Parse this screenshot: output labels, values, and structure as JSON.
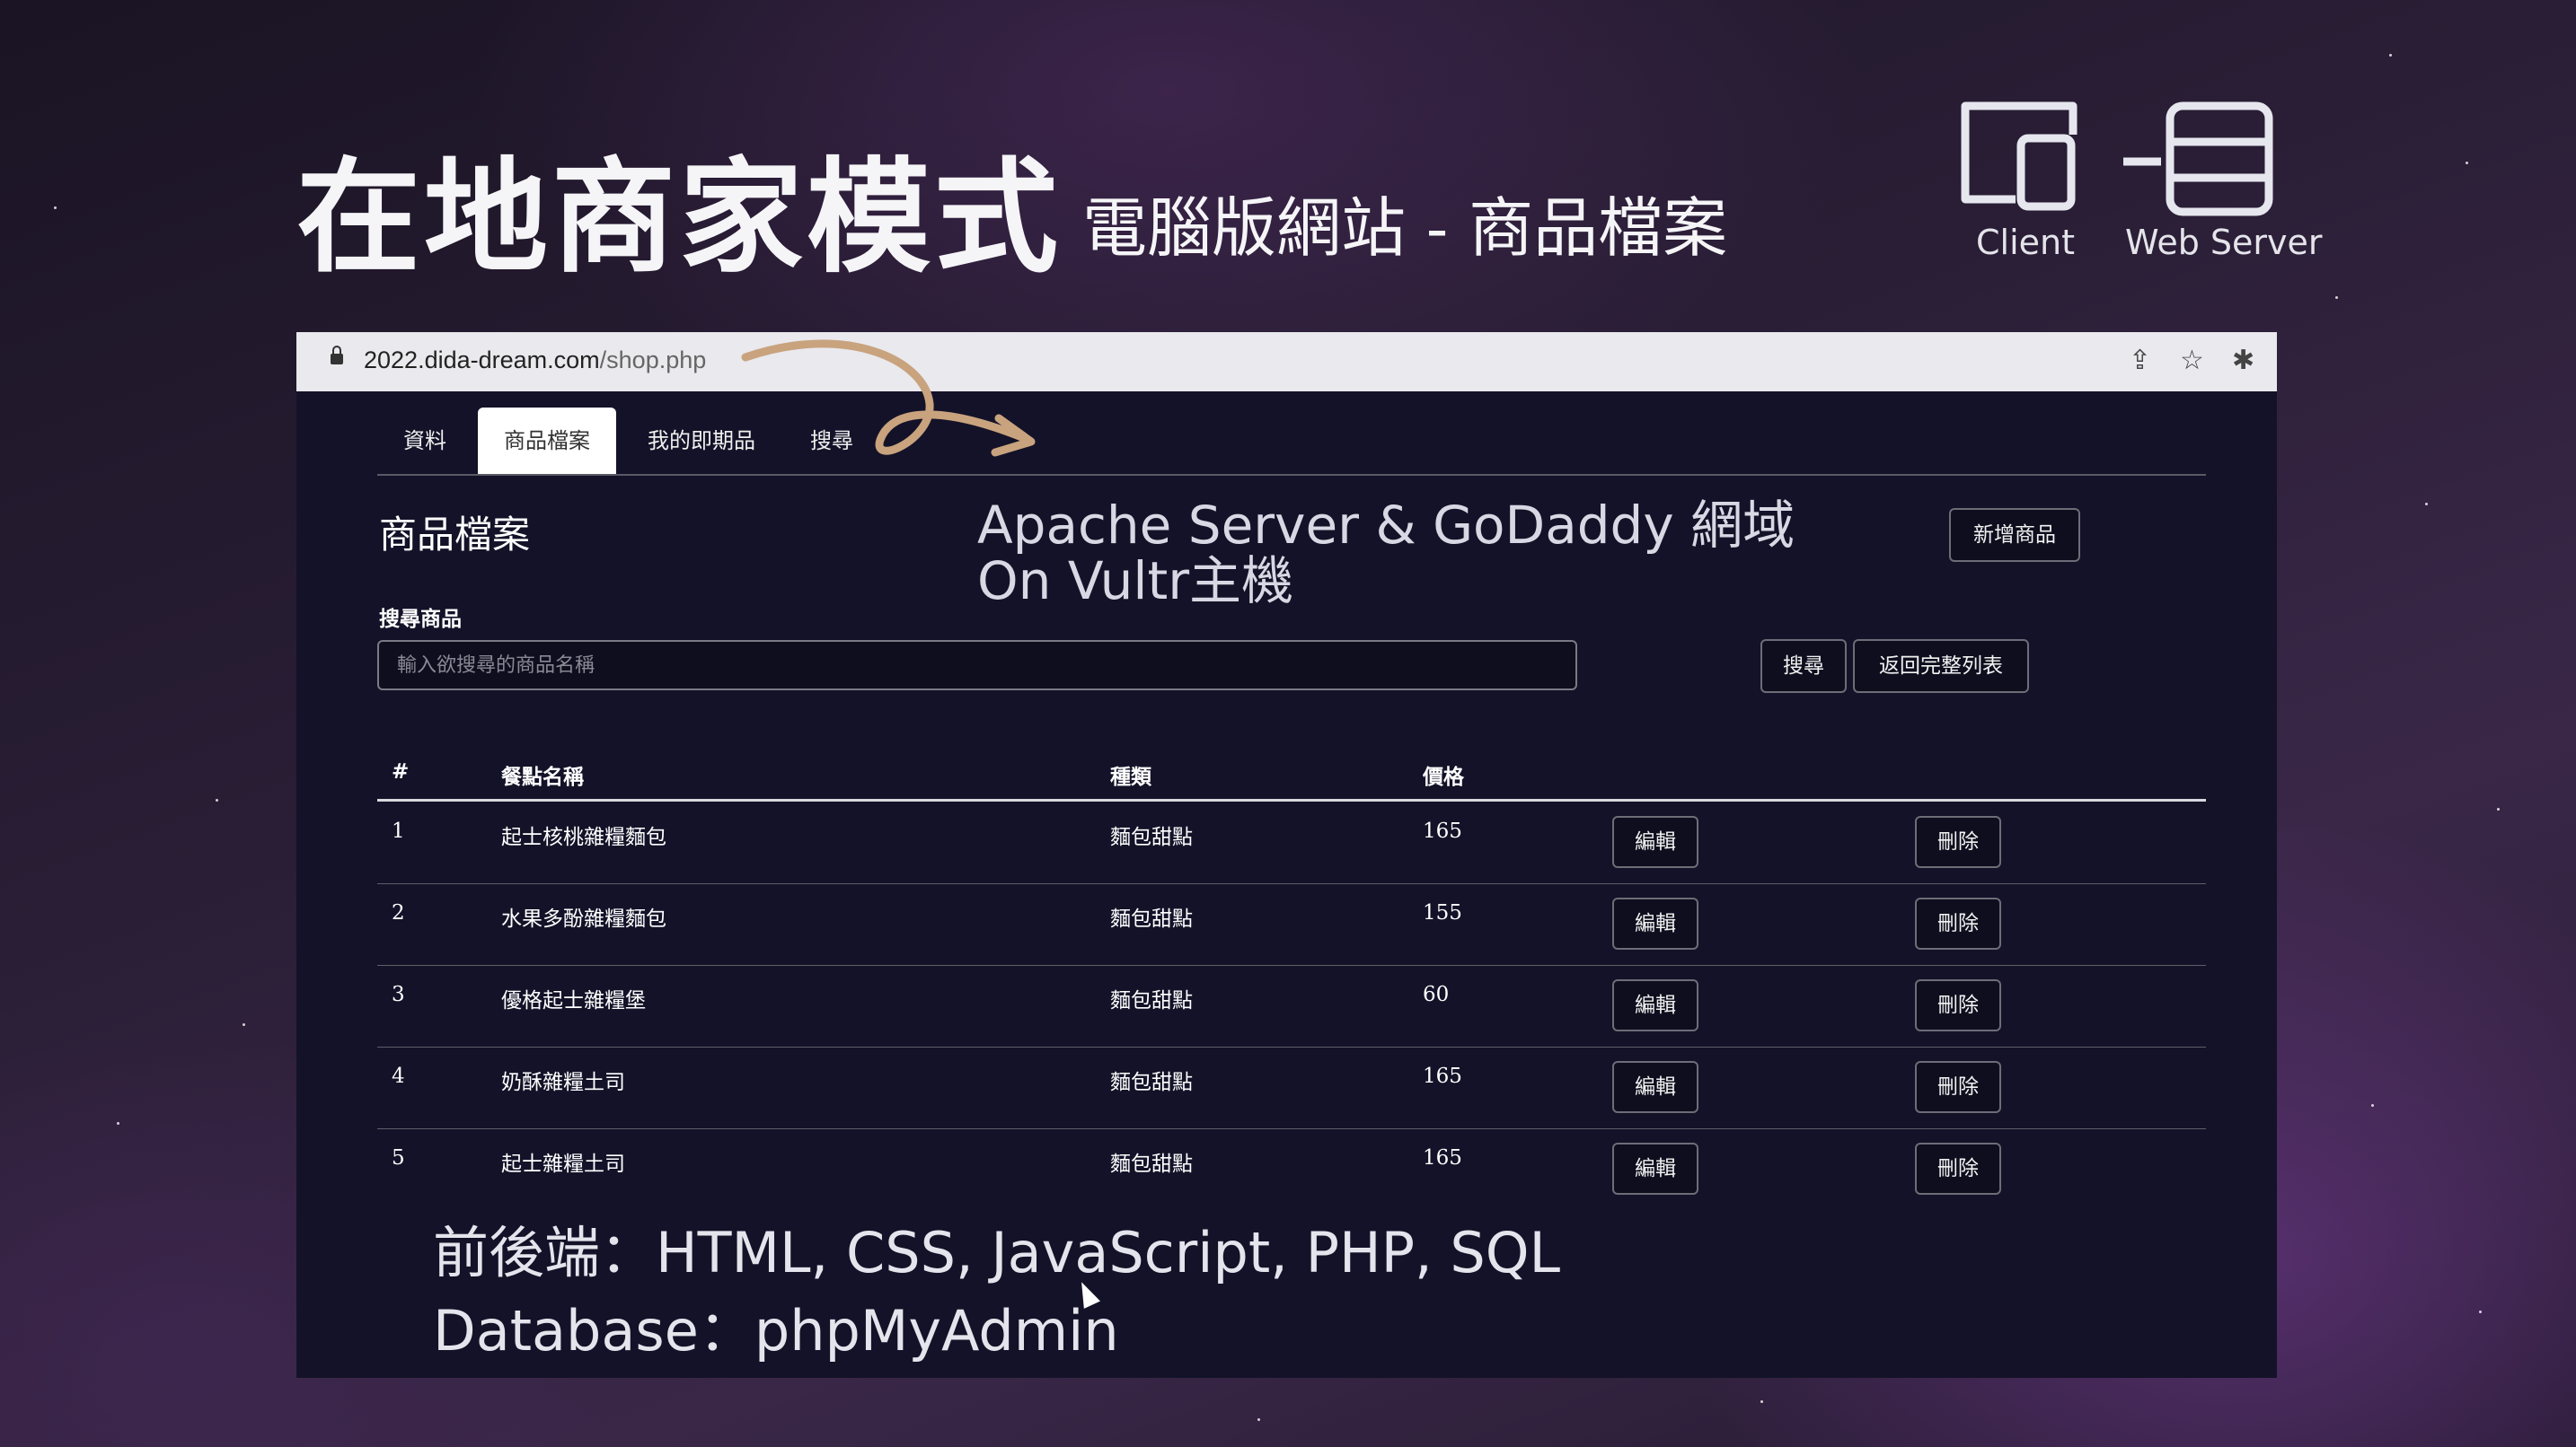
{
  "slide": {
    "title": "在地商家模式",
    "subtitle": "電腦版網站 - 商品檔案",
    "diagram": {
      "client_label": "Client",
      "server_label": "Web Server"
    },
    "overlay_line1": "Apache Server & GoDaddy 網域",
    "overlay_line2": "On Vultr主機",
    "bottom_line1": "前後端：HTML, CSS, JavaScript, PHP, SQL",
    "bottom_line2": "Database：phpMyAdmin"
  },
  "browser": {
    "url_domain": "2022.dida-dream.com",
    "url_path": "/shop.php",
    "icons": [
      "lock-icon",
      "share-icon",
      "star-icon",
      "extension-icon"
    ]
  },
  "app": {
    "tabs": [
      {
        "label": "資料",
        "active": false
      },
      {
        "label": "商品檔案",
        "active": true
      },
      {
        "label": "我的即期品",
        "active": false
      },
      {
        "label": "搜尋",
        "active": false
      }
    ],
    "page_title": "商品檔案",
    "add_button": "新增商品",
    "search": {
      "label": "搜尋商品",
      "placeholder": "輸入欲搜尋的商品名稱",
      "value": "",
      "search_button": "搜尋",
      "reset_button": "返回完整列表"
    },
    "table": {
      "headers": [
        "#",
        "餐點名稱",
        "種類",
        "價格"
      ],
      "rows": [
        {
          "id": "1",
          "name": "起士核桃雜糧麵包",
          "category": "麵包甜點",
          "price": "165",
          "edit": "編輯",
          "delete": "刪除"
        },
        {
          "id": "2",
          "name": "水果多酚雜糧麵包",
          "category": "麵包甜點",
          "price": "155",
          "edit": "編輯",
          "delete": "刪除"
        },
        {
          "id": "3",
          "name": "優格起士雜糧堡",
          "category": "麵包甜點",
          "price": "60",
          "edit": "編輯",
          "delete": "刪除"
        },
        {
          "id": "4",
          "name": "奶酥雜糧土司",
          "category": "麵包甜點",
          "price": "165",
          "edit": "編輯",
          "delete": "刪除"
        },
        {
          "id": "5",
          "name": "起士雜糧土司",
          "category": "麵包甜點",
          "price": "165",
          "edit": "編輯",
          "delete": "刪除"
        }
      ]
    }
  },
  "colors": {
    "accent_arrow": "#c8a37e",
    "browser_bg": "#141228"
  }
}
